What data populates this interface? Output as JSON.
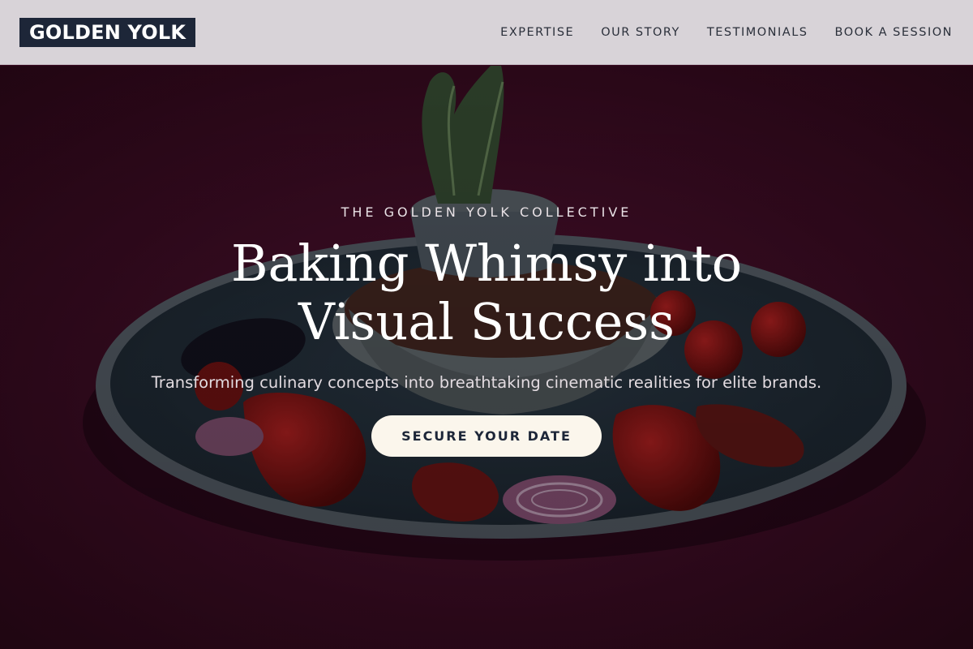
{
  "nav": {
    "logo": "GOLDEN YOLK",
    "links": [
      {
        "label": "EXPERTISE"
      },
      {
        "label": "OUR STORY"
      },
      {
        "label": "TESTIMONIALS"
      },
      {
        "label": "BOOK A SESSION"
      }
    ]
  },
  "hero": {
    "eyebrow": "THE GOLDEN YOLK COLLECTIVE",
    "headline_line1": "Baking Whimsy into",
    "headline_line2": "Visual Success",
    "subtitle": "Transforming culinary concepts into breathtaking cinematic realities for elite brands.",
    "cta_label": "SECURE YOUR DATE"
  },
  "colors": {
    "nav_background": "#d8d3d8",
    "logo_background": "#1d2638",
    "hero_background": "#3a0a22",
    "cta_background": "#fbf6ec"
  }
}
